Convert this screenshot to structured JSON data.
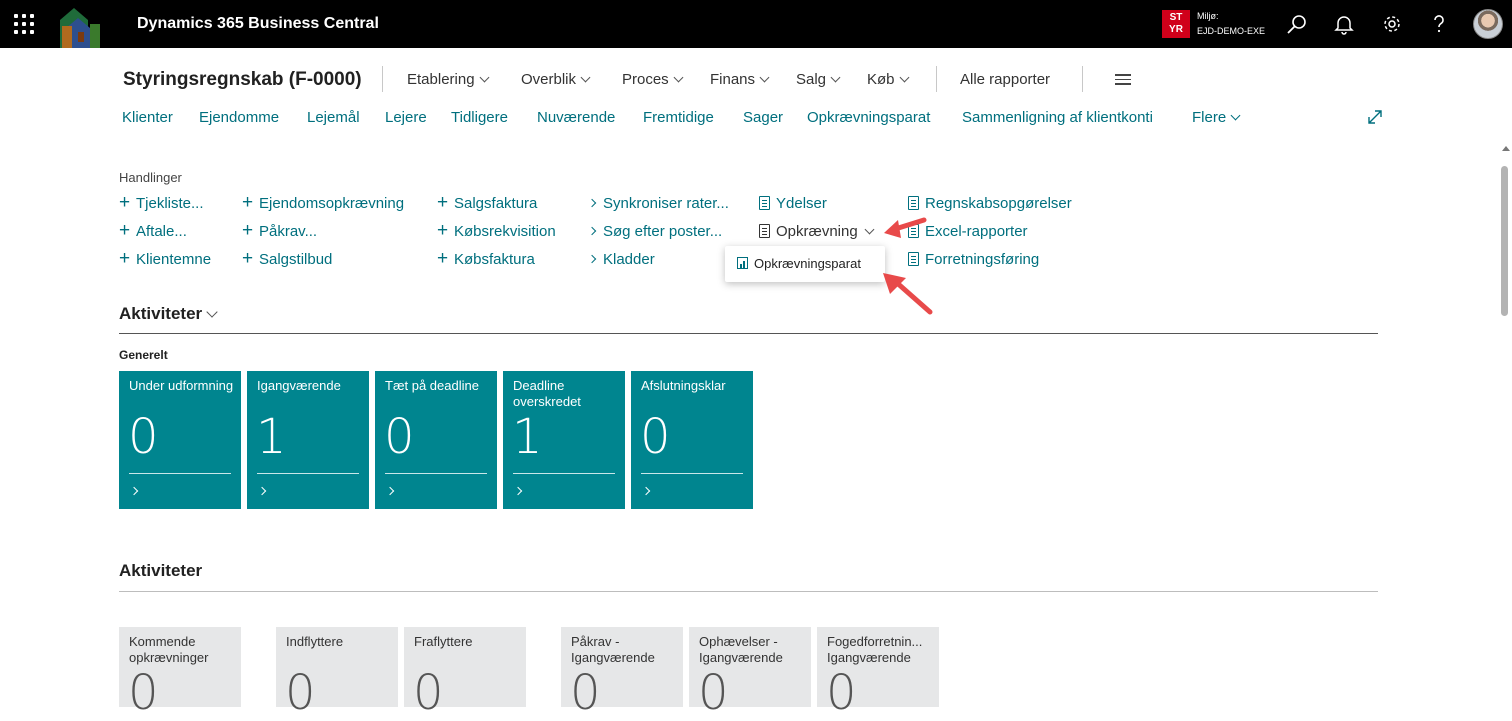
{
  "topbar": {
    "app_title": "Dynamics 365 Business Central",
    "env_badge": "ST YR",
    "env_label": "Miljø:",
    "env_name": "EJD-DEMO-EXE",
    "icons": [
      "waffle-icon",
      "search-icon",
      "bell-icon",
      "gear-icon",
      "help-icon",
      "avatar"
    ]
  },
  "page": {
    "title": "Styringsregnskab (F-0000)",
    "menus": [
      {
        "label": "Etablering"
      },
      {
        "label": "Overblik"
      },
      {
        "label": "Proces"
      },
      {
        "label": "Finans"
      },
      {
        "label": "Salg"
      },
      {
        "label": "Køb"
      }
    ],
    "all_reports": "Alle rapporter",
    "nav_links": [
      "Klienter",
      "Ejendomme",
      "Lejemål",
      "Lejere",
      "Tidligere",
      "Nuværende",
      "Fremtidige",
      "Sager",
      "Opkrævningsparat",
      "Sammenligning af klientkonti"
    ],
    "more_label": "Flere"
  },
  "actions": {
    "section_label": "Handlinger",
    "col1": [
      "Tjekliste...",
      "Aftale...",
      "Klientemne"
    ],
    "col2": [
      "Ejendomsopkrævning",
      "Påkrav...",
      "Salgstilbud"
    ],
    "col3": [
      "Salgsfaktura",
      "Købsrekvisition",
      "Købsfaktura"
    ],
    "col4": [
      "Synkroniser rater...",
      "Søg efter poster...",
      "Kladder"
    ],
    "col5": [
      "Ydelser",
      "Opkrævning"
    ],
    "col6": [
      "Regnskabsopgørelser",
      "Excel-rapporter",
      "Forretningsføring"
    ],
    "dropdown_item": "Opkrævningsparat"
  },
  "activities1": {
    "heading": "Aktiviteter",
    "group": "Generelt",
    "cues": [
      {
        "title": "Under udformning",
        "value": "0"
      },
      {
        "title": "Igangværende",
        "value": "1"
      },
      {
        "title": "Tæt på deadline",
        "value": "0"
      },
      {
        "title": "Deadline overskredet",
        "value": "1"
      },
      {
        "title": "Afslutningsklar",
        "value": "0"
      }
    ]
  },
  "activities2": {
    "heading": "Aktiviteter",
    "cues": [
      {
        "title": "Kommende opkrævninger",
        "value": "0"
      },
      {
        "title": "Indflyttere",
        "value": "0"
      },
      {
        "title": "Fraflyttere",
        "value": "0"
      },
      {
        "title": "Påkrav - Igangværende",
        "value": "0"
      },
      {
        "title": "Ophævelser - Igangværende",
        "value": "0"
      },
      {
        "title": "Fogedforretnin... Igangværende",
        "value": "0"
      }
    ]
  },
  "colors": {
    "topbar": "#000000",
    "link": "#006f7e",
    "cue_teal": "#00858f",
    "cue_grey": "#e6e7e8",
    "badge": "#d0001a",
    "annotation_arrow": "#e84a4a"
  }
}
